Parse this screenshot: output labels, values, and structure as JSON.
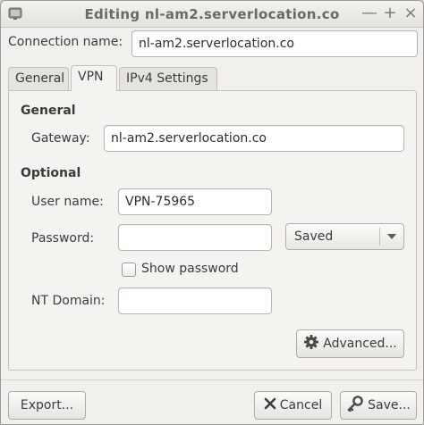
{
  "window": {
    "title": "Editing nl-am2.serverlocation.co",
    "controls": {
      "minimize": "—",
      "maximize": "+",
      "close": "×"
    }
  },
  "connection": {
    "label": "Connection name:",
    "value": "nl-am2.serverlocation.co"
  },
  "tabs": [
    {
      "label": "General",
      "active": false
    },
    {
      "label": "VPN",
      "active": true
    },
    {
      "label": "IPv4 Settings",
      "active": false
    }
  ],
  "vpn": {
    "general_heading": "General",
    "gateway_label": "Gateway:",
    "gateway_value": "nl-am2.serverlocation.co",
    "optional_heading": "Optional",
    "username_label": "User name:",
    "username_value": "VPN-75965",
    "password_label": "Password:",
    "password_value": "",
    "password_mode": "Saved",
    "show_password_label": "Show password",
    "show_password_checked": false,
    "nt_domain_label": "NT Domain:",
    "nt_domain_value": "",
    "advanced_button": "Advanced..."
  },
  "footer": {
    "export_button": "Export...",
    "cancel_button": "Cancel",
    "save_button": "Save..."
  },
  "icons": {
    "title": "network-icon",
    "advanced": "gear-icon",
    "cancel": "cancel-x-icon",
    "save": "key-icon"
  },
  "colors": {
    "window_bg": "#f1f0ed",
    "title_text": "#6a6965",
    "cancel_icon": "#3c3c3c"
  }
}
